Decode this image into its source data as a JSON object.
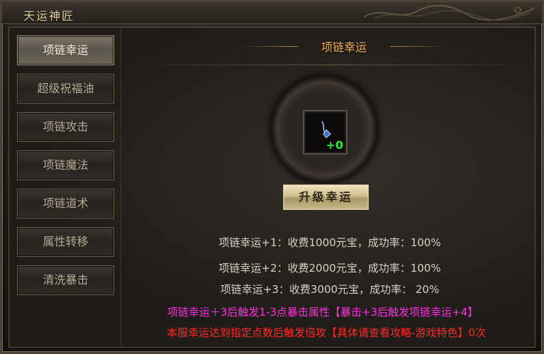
{
  "window": {
    "title": "天运神匠"
  },
  "tabs": [
    {
      "label": "项链幸运",
      "active": true
    },
    {
      "label": "超级祝福油",
      "active": false
    },
    {
      "label": "项链攻击",
      "active": false
    },
    {
      "label": "项链魔法",
      "active": false
    },
    {
      "label": "项链道术",
      "active": false
    },
    {
      "label": "属性转移",
      "active": false
    },
    {
      "label": "清洗暴击",
      "active": false
    }
  ],
  "panel": {
    "heading": "项链幸运",
    "item_slot": {
      "icon": "necklace-icon",
      "level_badge": "+0"
    },
    "upgrade_button": "升级幸运",
    "cost_lines": [
      "项链幸运+1：收费1000元宝，成功率：100%",
      "项链幸运+2：收费2000元宝，成功率：100%",
      "项链幸运+3：收费3000元宝，成功率： 20%"
    ],
    "note_pink": "项链幸运＋3后触发1-3点暴击属性【暴击+3后触发项链幸运+4】",
    "note_red": "本服幸运达到指定点数后触发倍攻【具体请查看攻略-游戏特色】0次"
  },
  "colors": {
    "heading": "#f0b35a",
    "level_badge": "#39e040",
    "note_pink": "#ff2ee2",
    "note_red": "#ff2a22"
  }
}
